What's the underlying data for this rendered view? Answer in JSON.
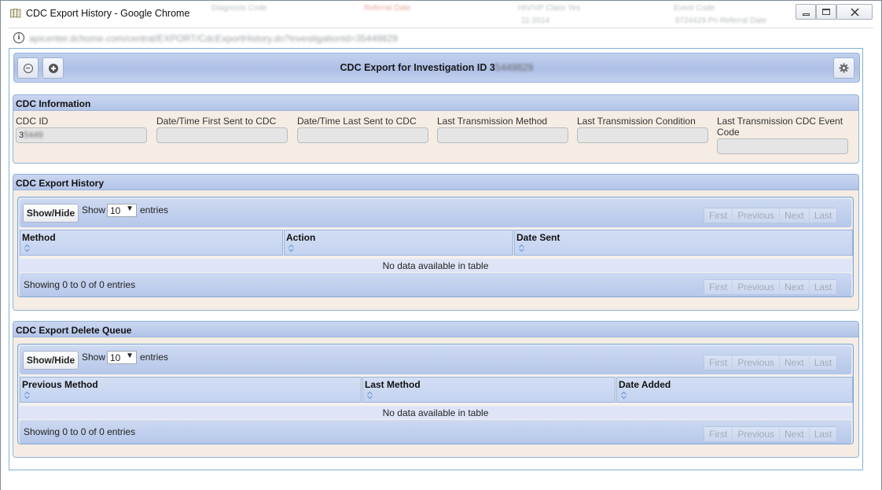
{
  "window": {
    "title": "CDC Export History - Google Chrome",
    "url": "apicenter.dchome.com/central/EXPORT/CdcExportHistory.do?investigationId=35449829",
    "ghost_texts": [
      "Diagnosis Code",
      "Referral Date",
      "HIV/VP Class Yes",
      "Event Code"
    ],
    "ghost_texts_row2": [
      "11-2014",
      "8724429 Pri Referral Date"
    ]
  },
  "header": {
    "title_prefix": "CDC Export for Investigation ID 3",
    "title_blurred": "5449829",
    "collapse_icon": "minus-circle-icon",
    "expand_icon": "plus-circle-icon",
    "settings_icon": "gear-icon"
  },
  "cdc_info": {
    "title": "CDC Information",
    "fields": [
      {
        "label": "CDC ID",
        "value": "3",
        "value_blurred": "5449"
      },
      {
        "label": "Date/Time First Sent to CDC",
        "value": ""
      },
      {
        "label": "Date/Time Last Sent to CDC",
        "value": ""
      },
      {
        "label": "Last Transmission Method",
        "value": ""
      },
      {
        "label": "Last Transmission Condition",
        "value": ""
      },
      {
        "label": "Last Transmission CDC Event Code",
        "value": ""
      }
    ]
  },
  "history": {
    "title": "CDC Export History",
    "show_hide": "Show/Hide",
    "show_label": "Show",
    "length_value": "10",
    "entries_label": "entries",
    "columns": [
      "Method",
      "Action",
      "Date Sent"
    ],
    "empty_text": "No data available in table",
    "info": "Showing 0 to 0 of 0 entries",
    "pager": [
      "First",
      "Previous",
      "Next",
      "Last"
    ]
  },
  "delete_queue": {
    "title": "CDC Export Delete Queue",
    "show_hide": "Show/Hide",
    "show_label": "Show",
    "length_value": "10",
    "entries_label": "entries",
    "columns": [
      "Previous Method",
      "Last Method",
      "Date Added"
    ],
    "empty_text": "No data available in table",
    "info": "Showing 0 to 0 of 0 entries",
    "pager": [
      "First",
      "Previous",
      "Next",
      "Last"
    ]
  }
}
